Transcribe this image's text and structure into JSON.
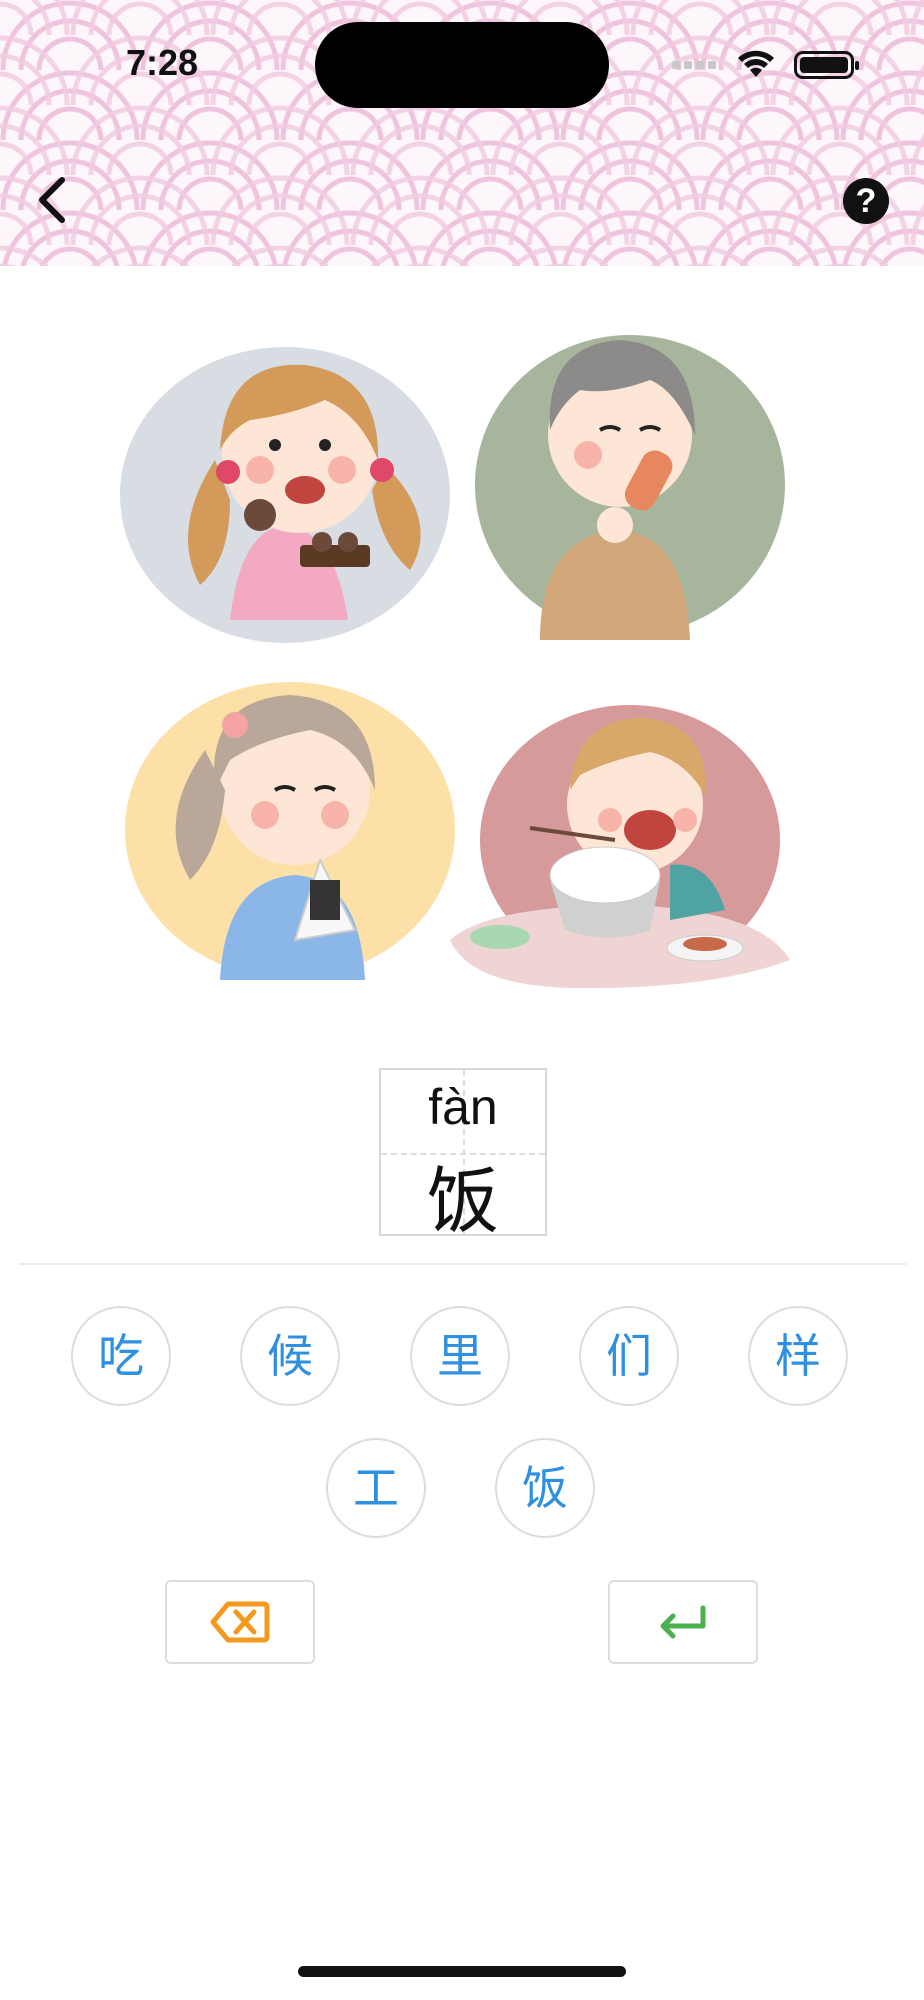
{
  "status_bar": {
    "time": "7:28"
  },
  "nav": {
    "back_icon": "chevron-left-icon",
    "help_label": "?"
  },
  "illustration": {
    "description_icon": "children-eating-illustration"
  },
  "card": {
    "pinyin": "fàn",
    "hanzi": "饭"
  },
  "options": [
    "吃",
    "候",
    "里",
    "们",
    "样",
    "工",
    "饭"
  ],
  "actions": {
    "delete_icon": "backspace-icon",
    "enter_icon": "return-icon",
    "delete_color": "#f39a1e",
    "enter_color": "#4caf50"
  },
  "colors": {
    "accent": "#2f8fe0",
    "pattern": "#efc3dd"
  }
}
